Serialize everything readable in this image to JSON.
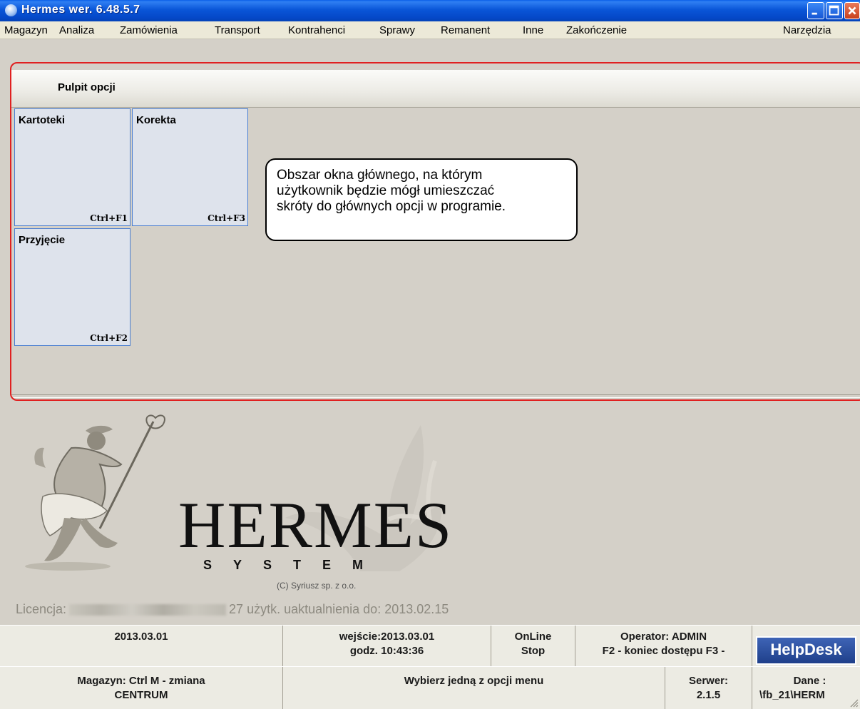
{
  "window": {
    "title": "Hermes wer. 6.48.5.7"
  },
  "menu": [
    {
      "label": "Magazyn"
    },
    {
      "label": "Analiza"
    },
    {
      "label": "Zamówienia"
    },
    {
      "label": "Transport"
    },
    {
      "label": "Kontrahenci"
    },
    {
      "label": "Sprawy"
    },
    {
      "label": "Remanent"
    },
    {
      "label": "Inne"
    },
    {
      "label": "Zakończenie"
    },
    {
      "label": "Narzędzia"
    }
  ],
  "pulpit": {
    "title": "Pulpit opcji",
    "tiles": [
      {
        "name": "Kartoteki",
        "shortcut": "Ctrl+F1"
      },
      {
        "name": "Korekta",
        "shortcut": "Ctrl+F3"
      },
      {
        "name": "Przyjęcie",
        "shortcut": "Ctrl+F2"
      }
    ],
    "callout": [
      "Obszar okna głównego, na którym",
      "użytkownik będzie mógł umieszczać",
      "skróty do głównych opcji w programie."
    ]
  },
  "logo": {
    "word": "HERMES",
    "subword": "SYSTEM",
    "copyright": "(C) Syriusz sp. z o.o.",
    "license_label": "Licencja:",
    "license_info": "27 użytk. uaktualnienia do: 2013.02.15"
  },
  "status": {
    "date": "2013.03.01",
    "entry": "wejście:2013.03.01",
    "time": "godz. 10:43:36",
    "online": "OnLine",
    "stop": "Stop",
    "operator": "Operator: ADMIN",
    "keys": "F2 - koniec dostępu   F3 -",
    "helpdesk": "HelpDesk",
    "warehouse_hint": "Magazyn: Ctrl M - zmiana",
    "warehouse": "CENTRUM",
    "message": "Wybierz jedną z opcji menu",
    "server_label": "Serwer:",
    "server_version": "2.1.5",
    "data_label": "Dane  :",
    "data_path": "\\fb_21\\HERM"
  },
  "colors": {
    "titlebar": "#0a56d8",
    "tile_border": "#4a7ed1",
    "highlight_frame": "#e02020",
    "helpdesk": "#2a4c9c"
  }
}
